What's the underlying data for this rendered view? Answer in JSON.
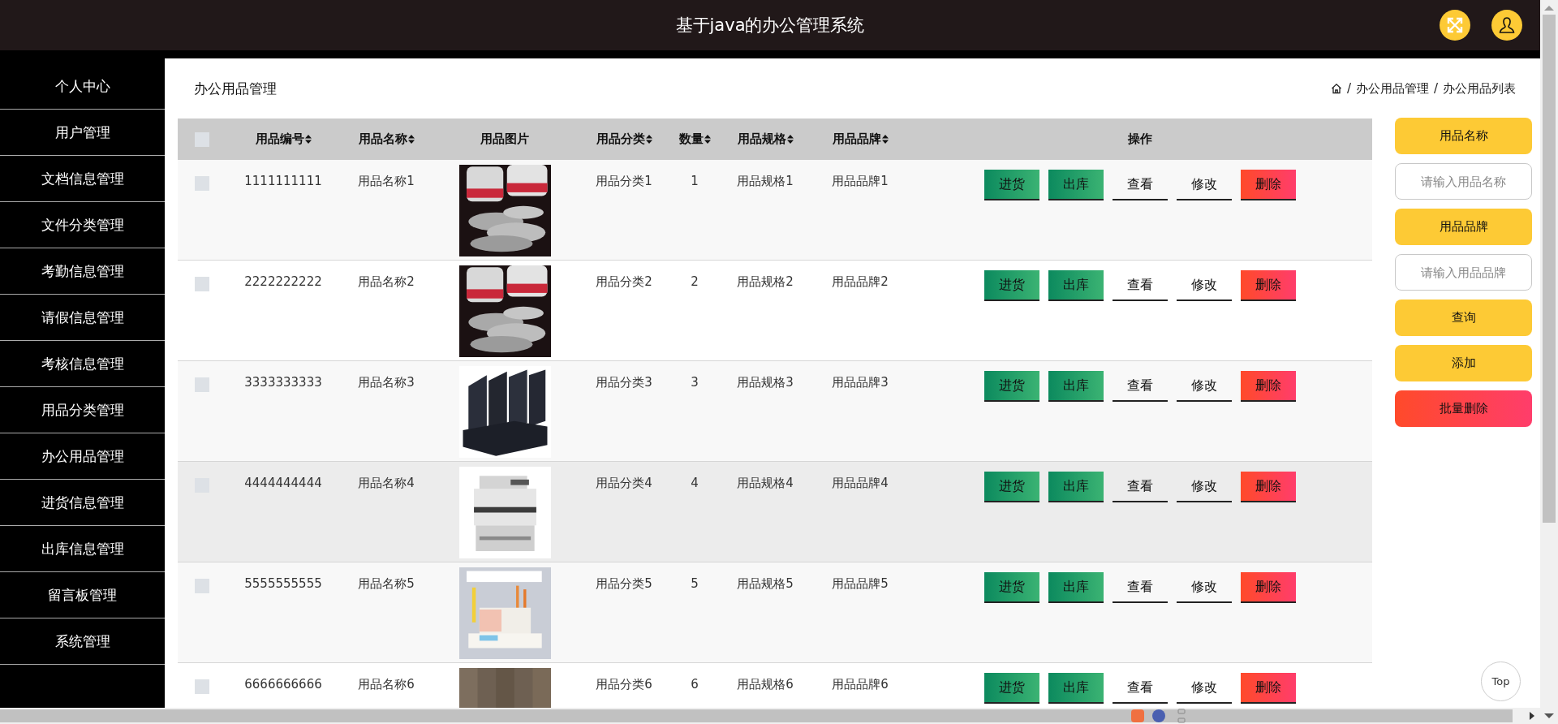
{
  "header": {
    "title": "基于java的办公管理系统"
  },
  "sidebar": {
    "items": [
      {
        "label": "个人中心"
      },
      {
        "label": "用户管理"
      },
      {
        "label": "文档信息管理"
      },
      {
        "label": "文件分类管理"
      },
      {
        "label": "考勤信息管理"
      },
      {
        "label": "请假信息管理"
      },
      {
        "label": "考核信息管理"
      },
      {
        "label": "用品分类管理"
      },
      {
        "label": "办公用品管理"
      },
      {
        "label": "进货信息管理"
      },
      {
        "label": "出库信息管理"
      },
      {
        "label": "留言板管理"
      },
      {
        "label": "系统管理"
      }
    ]
  },
  "page_title": "办公用品管理",
  "breadcrumb": [
    {
      "kind": "home"
    },
    {
      "kind": "separator",
      "text": "/"
    },
    {
      "kind": "link",
      "text": "办公用品管理"
    },
    {
      "kind": "separator",
      "text": "/"
    },
    {
      "kind": "current",
      "text": "办公用品列表"
    }
  ],
  "table": {
    "select_all": {
      "checked": false
    },
    "columns": [
      {
        "label": "用品编号",
        "sortable": true
      },
      {
        "label": "用品名称",
        "sortable": true
      },
      {
        "label": "用品图片",
        "sortable": false
      },
      {
        "label": "用品分类",
        "sortable": true
      },
      {
        "label": "数量",
        "sortable": true
      },
      {
        "label": "用品规格",
        "sortable": true
      },
      {
        "label": "用品品牌",
        "sortable": true
      },
      {
        "label": "操作",
        "sortable": false
      }
    ],
    "rows": [
      {
        "checked": false,
        "highlighted": false,
        "code": "1111111111",
        "name": "用品名称1",
        "image": {
          "kind": "picture"
        },
        "category": "用品分类1",
        "quantity": "1",
        "spec": "用品规格1",
        "brand": "用品品牌1",
        "actions": [
          {
            "label": "进货",
            "kind": "success"
          },
          {
            "label": "出库",
            "kind": "success"
          },
          {
            "label": "查看",
            "kind": "plain"
          },
          {
            "label": "修改",
            "kind": "plain"
          },
          {
            "label": "删除",
            "kind": "danger"
          }
        ]
      },
      {
        "checked": false,
        "highlighted": false,
        "code": "2222222222",
        "name": "用品名称2",
        "image": {
          "kind": "picture"
        },
        "category": "用品分类2",
        "quantity": "2",
        "spec": "用品规格2",
        "brand": "用品品牌2",
        "actions": [
          {
            "label": "进货",
            "kind": "success"
          },
          {
            "label": "出库",
            "kind": "success"
          },
          {
            "label": "查看",
            "kind": "plain"
          },
          {
            "label": "修改",
            "kind": "plain"
          },
          {
            "label": "删除",
            "kind": "danger"
          }
        ]
      },
      {
        "checked": false,
        "highlighted": false,
        "code": "3333333333",
        "name": "用品名称3",
        "image": {
          "kind": "picture"
        },
        "category": "用品分类3",
        "quantity": "3",
        "spec": "用品规格3",
        "brand": "用品品牌3",
        "actions": [
          {
            "label": "进货",
            "kind": "success"
          },
          {
            "label": "出库",
            "kind": "success"
          },
          {
            "label": "查看",
            "kind": "plain"
          },
          {
            "label": "修改",
            "kind": "plain"
          },
          {
            "label": "删除",
            "kind": "danger"
          }
        ]
      },
      {
        "checked": false,
        "highlighted": true,
        "code": "4444444444",
        "name": "用品名称4",
        "image": {
          "kind": "picture"
        },
        "category": "用品分类4",
        "quantity": "4",
        "spec": "用品规格4",
        "brand": "用品品牌4",
        "actions": [
          {
            "label": "进货",
            "kind": "success"
          },
          {
            "label": "出库",
            "kind": "success"
          },
          {
            "label": "查看",
            "kind": "plain"
          },
          {
            "label": "修改",
            "kind": "plain"
          },
          {
            "label": "删除",
            "kind": "danger"
          }
        ]
      },
      {
        "checked": false,
        "highlighted": false,
        "code": "5555555555",
        "name": "用品名称5",
        "image": {
          "kind": "picture"
        },
        "category": "用品分类5",
        "quantity": "5",
        "spec": "用品规格5",
        "brand": "用品品牌5",
        "actions": [
          {
            "label": "进货",
            "kind": "success"
          },
          {
            "label": "出库",
            "kind": "success"
          },
          {
            "label": "查看",
            "kind": "plain"
          },
          {
            "label": "修改",
            "kind": "plain"
          },
          {
            "label": "删除",
            "kind": "danger"
          }
        ]
      },
      {
        "checked": false,
        "highlighted": false,
        "code": "6666666666",
        "name": "用品名称6",
        "image": {
          "kind": "picture"
        },
        "category": "用品分类6",
        "quantity": "6",
        "spec": "用品规格6",
        "brand": "用品品牌6",
        "actions": [
          {
            "label": "进货",
            "kind": "success"
          },
          {
            "label": "出库",
            "kind": "success"
          },
          {
            "label": "查看",
            "kind": "plain"
          },
          {
            "label": "修改",
            "kind": "plain"
          },
          {
            "label": "删除",
            "kind": "danger"
          }
        ]
      }
    ]
  },
  "search_panel": {
    "items": [
      {
        "kind": "label",
        "text": "用品名称"
      },
      {
        "kind": "input",
        "placeholder": "请输入用品名称"
      },
      {
        "kind": "label",
        "text": "用品品牌"
      },
      {
        "kind": "input",
        "placeholder": "请输入用品品牌"
      },
      {
        "kind": "button",
        "text": "查询"
      },
      {
        "kind": "button",
        "text": "添加"
      },
      {
        "kind": "danger",
        "text": "批量删除"
      }
    ]
  },
  "back_to_top": "Top"
}
